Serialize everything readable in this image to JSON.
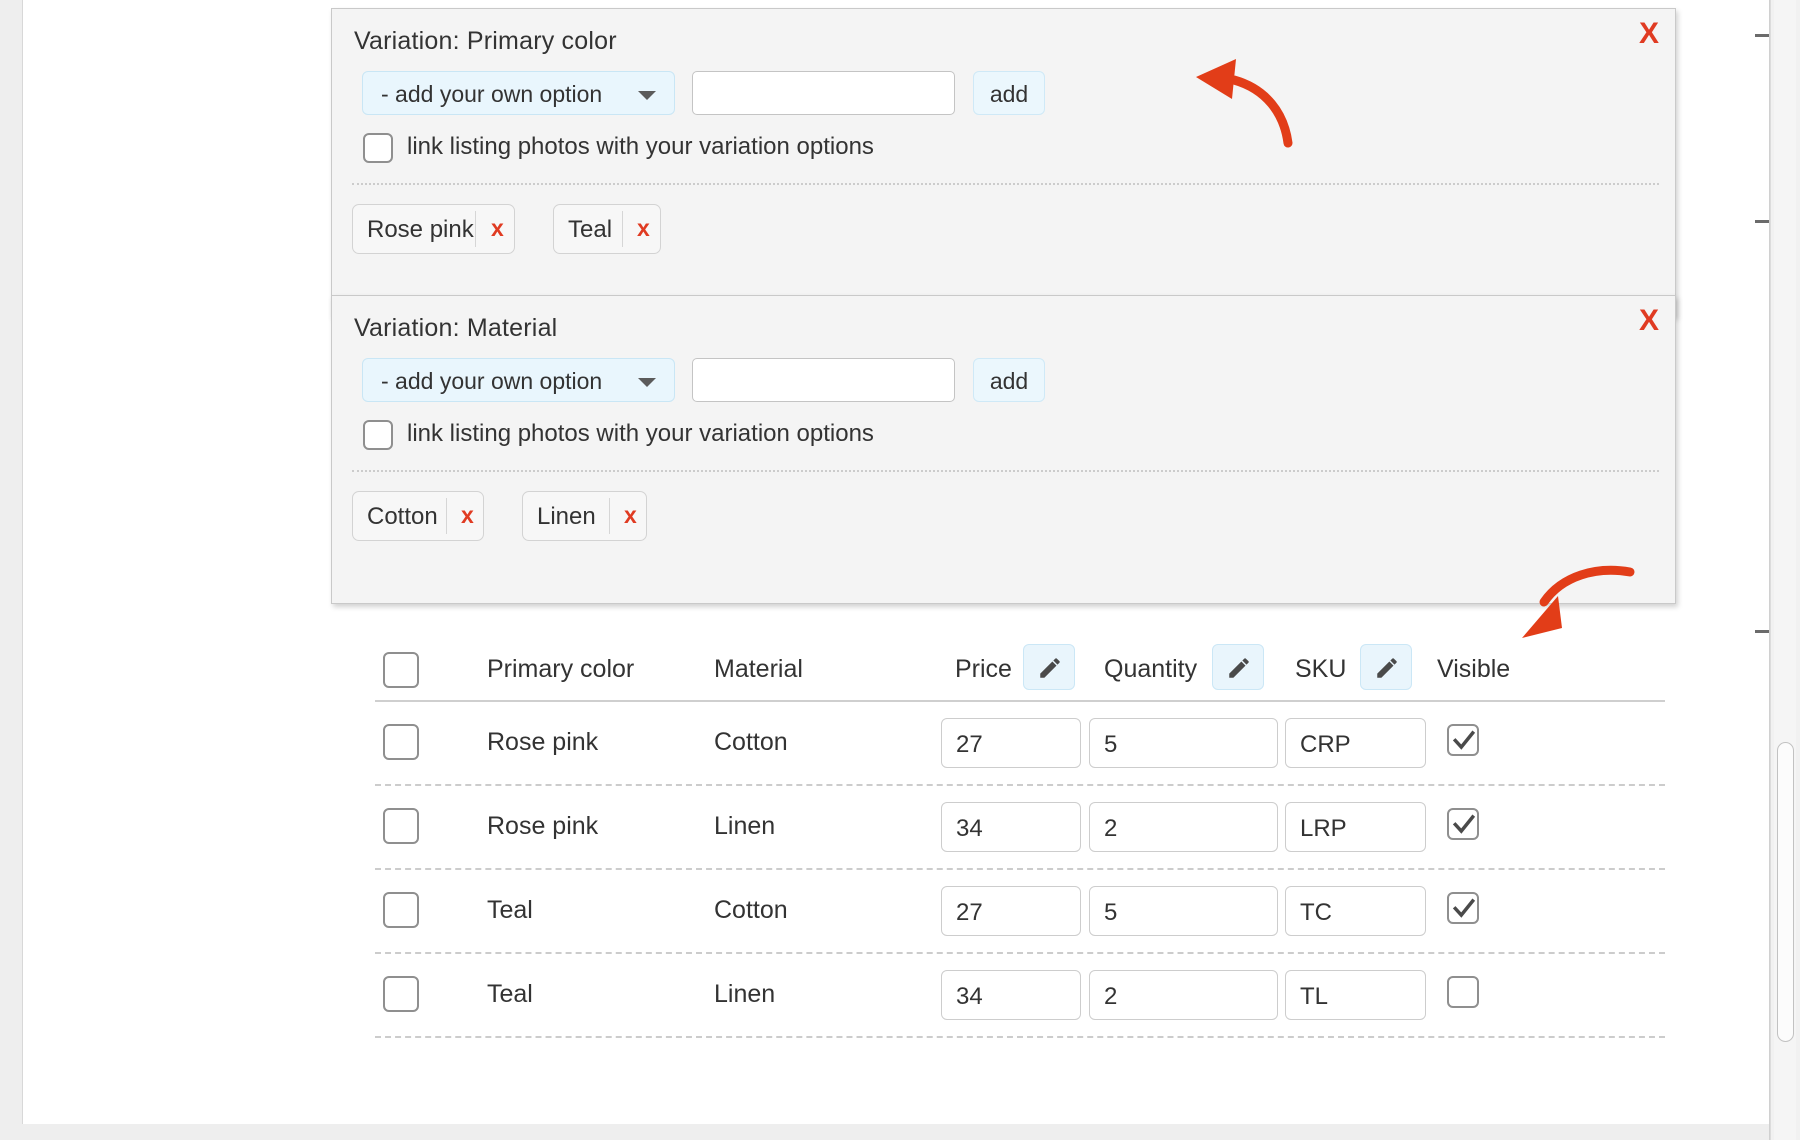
{
  "variations": [
    {
      "title": "Variation: Primary color",
      "close_label": "X",
      "select_value": "- add your own option",
      "input_value": "",
      "add_label": "add",
      "link_photos_label": "link listing photos with your variation options",
      "link_photos_checked": false,
      "options": [
        {
          "label": "Rose pink",
          "remove_label": "x"
        },
        {
          "label": "Teal",
          "remove_label": "x"
        }
      ]
    },
    {
      "title": "Variation: Material",
      "close_label": "X",
      "select_value": "- add your own option",
      "input_value": "",
      "add_label": "add",
      "link_photos_label": "link listing photos with your variation options",
      "link_photos_checked": false,
      "options": [
        {
          "label": "Cotton",
          "remove_label": "x"
        },
        {
          "label": "Linen",
          "remove_label": "x"
        }
      ]
    }
  ],
  "table": {
    "headers": {
      "select_all": "",
      "primary_color": "Primary color",
      "material": "Material",
      "price": "Price",
      "quantity": "Quantity",
      "sku": "SKU",
      "visible": "Visible"
    },
    "rows": [
      {
        "selected": false,
        "primary_color": "Rose pink",
        "material": "Cotton",
        "price": "27",
        "quantity": "5",
        "sku": "CRP",
        "visible": true
      },
      {
        "selected": false,
        "primary_color": "Rose pink",
        "material": "Linen",
        "price": "34",
        "quantity": "2",
        "sku": "LRP",
        "visible": true
      },
      {
        "selected": false,
        "primary_color": "Teal",
        "material": "Cotton",
        "price": "27",
        "quantity": "5",
        "sku": "TC",
        "visible": true
      },
      {
        "selected": false,
        "primary_color": "Teal",
        "material": "Linen",
        "price": "34",
        "quantity": "2",
        "sku": "TL",
        "visible": false
      }
    ]
  },
  "annotations": {
    "arrow_to_add_button": "red-curved-arrow-pointing-left-at-add-button",
    "arrow_to_sku_pencil": "red-curved-arrow-pointing-down-at-sku-edit-button"
  },
  "colors": {
    "accent_red": "#e03b22",
    "panel_bg": "#f4f4f4",
    "field_blue": "#e9f6fd"
  }
}
